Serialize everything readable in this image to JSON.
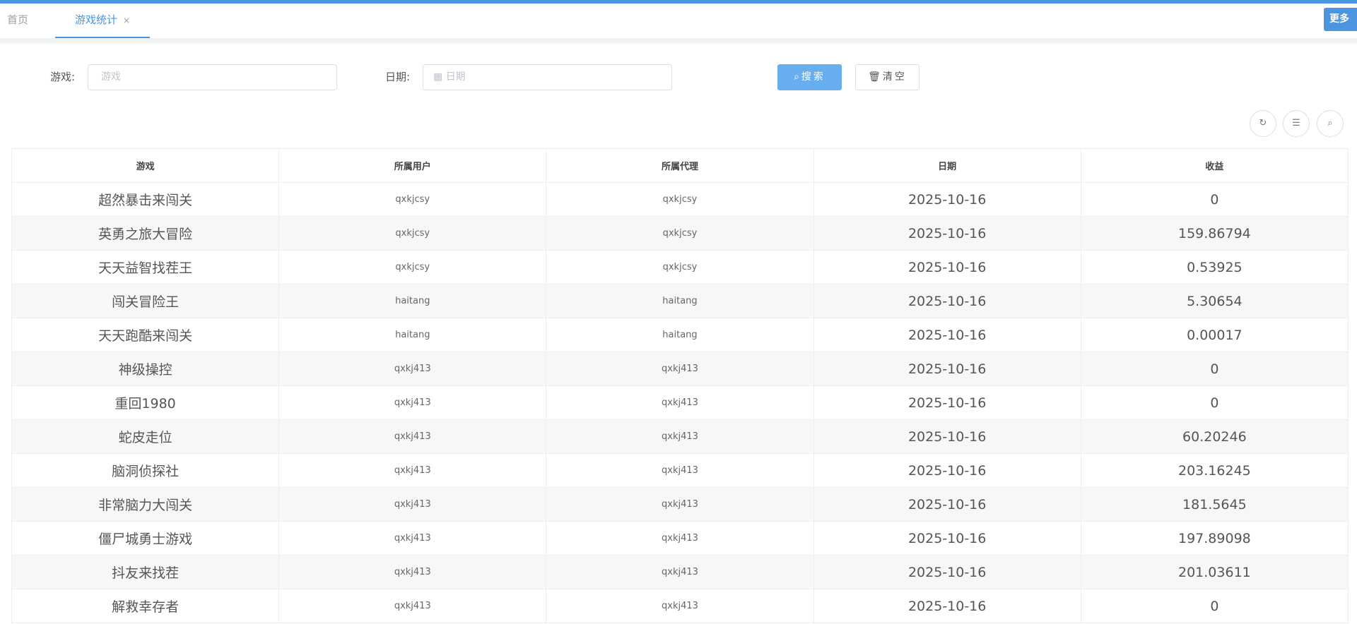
{
  "tabs": {
    "home": "首页",
    "active": "游戏统计",
    "close": "×",
    "more": "更多"
  },
  "filters": {
    "game_label": "游戏:",
    "game_placeholder": "游戏",
    "date_label": "日期:",
    "date_placeholder": "日期",
    "search": "搜索",
    "clear": "清空"
  },
  "table": {
    "headers": [
      "游戏",
      "所属用户",
      "所属代理",
      "日期",
      "收益"
    ],
    "rows": [
      [
        "超然暴击来闯关",
        "qxkjcsy",
        "qxkjcsy",
        "2025-10-16",
        "0"
      ],
      [
        "英勇之旅大冒险",
        "qxkjcsy",
        "qxkjcsy",
        "2025-10-16",
        "159.86794"
      ],
      [
        "天天益智找茬王",
        "qxkjcsy",
        "qxkjcsy",
        "2025-10-16",
        "0.53925"
      ],
      [
        "闯关冒险王",
        "haitang",
        "haitang",
        "2025-10-16",
        "5.30654"
      ],
      [
        "天天跑酷来闯关",
        "haitang",
        "haitang",
        "2025-10-16",
        "0.00017"
      ],
      [
        "神级操控",
        "qxkj413",
        "qxkj413",
        "2025-10-16",
        "0"
      ],
      [
        "重回1980",
        "qxkj413",
        "qxkj413",
        "2025-10-16",
        "0"
      ],
      [
        "蛇皮走位",
        "qxkj413",
        "qxkj413",
        "2025-10-16",
        "60.20246"
      ],
      [
        "脑洞侦探社",
        "qxkj413",
        "qxkj413",
        "2025-10-16",
        "203.16245"
      ],
      [
        "非常脑力大闯关",
        "qxkj413",
        "qxkj413",
        "2025-10-16",
        "181.5645"
      ],
      [
        "僵尸城勇士游戏",
        "qxkj413",
        "qxkj413",
        "2025-10-16",
        "197.89098"
      ],
      [
        "抖友来找茬",
        "qxkj413",
        "qxkj413",
        "2025-10-16",
        "201.03611"
      ],
      [
        "解救幸存者",
        "qxkj413",
        "qxkj413",
        "2025-10-16",
        "0"
      ]
    ]
  }
}
